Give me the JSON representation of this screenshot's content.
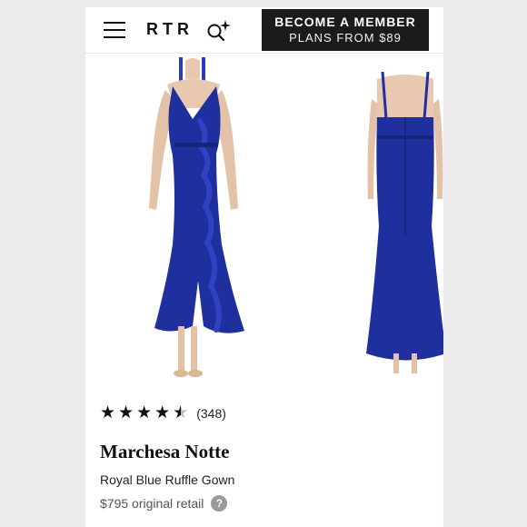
{
  "header": {
    "logo": "RTR",
    "cta_line1": "BECOME A MEMBER",
    "cta_line2": "PLANS FROM $89"
  },
  "icons": {
    "menu": "hamburger-menu-icon",
    "search": "sparkle-search-icon",
    "help": "question-icon"
  },
  "product": {
    "rating": 4.5,
    "review_count": "(348)",
    "designer": "Marchesa Notte",
    "name": "Royal Blue Ruffle Gown",
    "price": "$795 original retail",
    "help_glyph": "?"
  },
  "colors": {
    "dress": "#1f2f9e",
    "cta_bg": "#1b1b1b"
  }
}
